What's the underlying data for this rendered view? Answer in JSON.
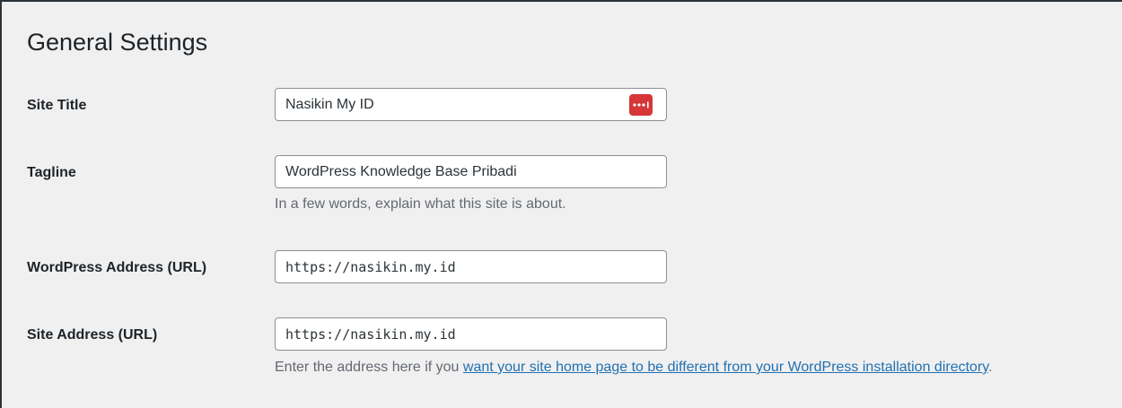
{
  "page": {
    "title": "General Settings"
  },
  "fields": {
    "site_title": {
      "label": "Site Title",
      "value": "Nasikin My ID",
      "password_manager_icon": "password-manager-icon"
    },
    "tagline": {
      "label": "Tagline",
      "value": "WordPress Knowledge Base Pribadi",
      "description": "In a few words, explain what this site is about."
    },
    "wordpress_address": {
      "label": "WordPress Address (URL)",
      "value": "https://nasikin.my.id"
    },
    "site_address": {
      "label": "Site Address (URL)",
      "value": "https://nasikin.my.id",
      "description_prefix": "Enter the address here if you ",
      "description_link": "want your site home page to be different from your WordPress installation directory",
      "description_suffix": "."
    }
  },
  "colors": {
    "background": "#f0f0f1",
    "link": "#2271b1",
    "badge": "#d63638"
  }
}
